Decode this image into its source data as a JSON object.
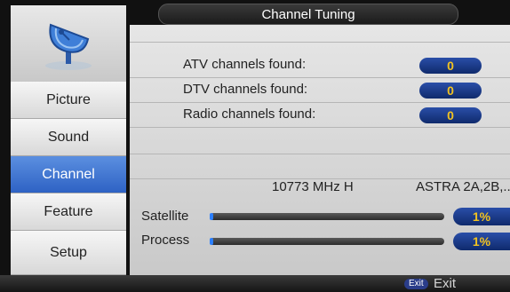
{
  "header": {
    "title": "Channel Tuning"
  },
  "sidebar": {
    "logo_icon": "satellite-dish-icon",
    "items": [
      {
        "label": "Picture",
        "active": false
      },
      {
        "label": "Sound",
        "active": false
      },
      {
        "label": "Channel",
        "active": true
      },
      {
        "label": "Feature",
        "active": false
      },
      {
        "label": "Setup",
        "active": false
      }
    ]
  },
  "main": {
    "counts": [
      {
        "label": "ATV channels found:",
        "value": "0"
      },
      {
        "label": "DTV channels found:",
        "value": "0"
      },
      {
        "label": "Radio channels found:",
        "value": "0"
      }
    ],
    "frequency": "10773 MHz H",
    "satellite_name": "ASTRA 2A,2B,...",
    "satellite": {
      "label": "Satellite",
      "percent": "1%",
      "progress": 0.01
    },
    "process": {
      "label": "Process",
      "percent": "1%",
      "progress": 0.01
    }
  },
  "footer": {
    "exit_key": "Exit",
    "exit_label": "Exit"
  },
  "colors": {
    "accent": "#2e62c4",
    "value_text": "#f2c321",
    "pill": "#1a3a8a"
  }
}
